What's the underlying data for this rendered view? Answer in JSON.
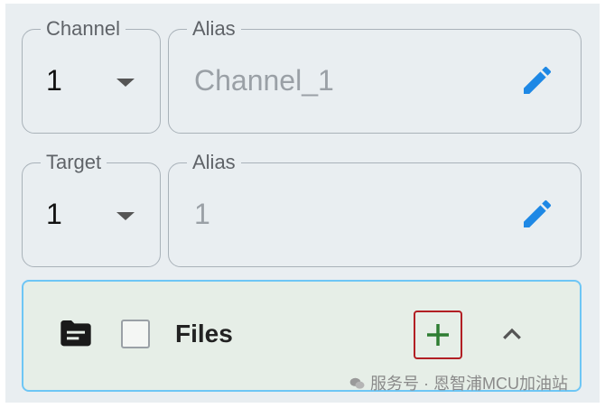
{
  "channel": {
    "label": "Channel",
    "value": "1",
    "alias_label": "Alias",
    "alias_value": "Channel_1"
  },
  "target": {
    "label": "Target",
    "value": "1",
    "alias_label": "Alias",
    "alias_value": "1"
  },
  "files": {
    "label": "Files"
  },
  "watermark": "服务号 · 恩智浦MCU加油站",
  "colors": {
    "edit_icon": "#1e88e5",
    "add_icon": "#2e7d32",
    "add_highlight": "#b21f24",
    "files_border": "#6ec6f5"
  },
  "icons": [
    "chevron-down-icon",
    "pencil-icon",
    "folder-icon",
    "plus-icon",
    "chevron-up-icon",
    "wechat-icon"
  ]
}
